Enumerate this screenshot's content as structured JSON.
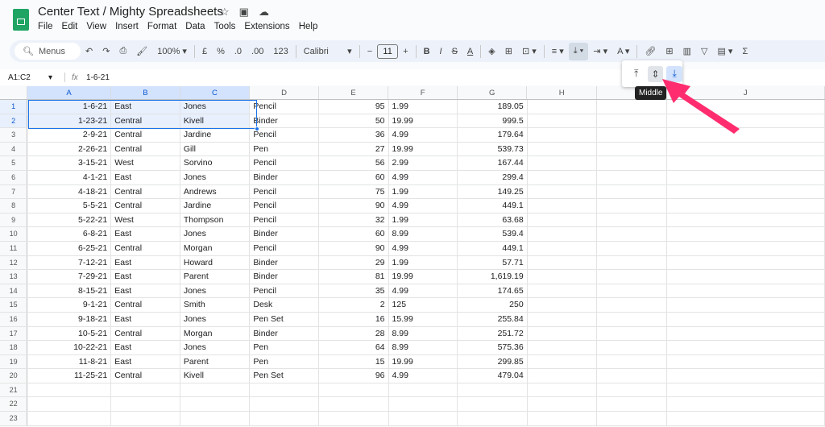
{
  "app": {
    "title": "Center Text / Mighty Spreadsheets",
    "menu": [
      "File",
      "Edit",
      "View",
      "Insert",
      "Format",
      "Data",
      "Tools",
      "Extensions",
      "Help"
    ]
  },
  "toolbar": {
    "search": "Menus",
    "zoom": "100%",
    "currency": "£",
    "percent": "%",
    "dec_less": ".0",
    "dec_more": ".00",
    "format": "123",
    "font": "Calibri",
    "font_size": "11"
  },
  "formula_bar": {
    "range": "A1:C2",
    "fx": "fx",
    "value": "1-6-21"
  },
  "valign_popup": {
    "options": [
      "Top",
      "Middle",
      "Bottom"
    ],
    "selected": "Bottom",
    "hovered": "Middle",
    "tooltip": "Middle"
  },
  "annotation_color": "#ff2d6f",
  "columns": [
    "A",
    "B",
    "C",
    "D",
    "E",
    "F",
    "G",
    "H",
    "",
    "J"
  ],
  "rows": [
    [
      "1-6-21",
      "East",
      "Jones",
      "Pencil",
      "95",
      "1.99",
      "189.05"
    ],
    [
      "1-23-21",
      "Central",
      "Kivell",
      "Binder",
      "50",
      "19.99",
      "999.5"
    ],
    [
      "2-9-21",
      "Central",
      "Jardine",
      "Pencil",
      "36",
      "4.99",
      "179.64"
    ],
    [
      "2-26-21",
      "Central",
      "Gill",
      "Pen",
      "27",
      "19.99",
      "539.73"
    ],
    [
      "3-15-21",
      "West",
      "Sorvino",
      "Pencil",
      "56",
      "2.99",
      "167.44"
    ],
    [
      "4-1-21",
      "East",
      "Jones",
      "Binder",
      "60",
      "4.99",
      "299.4"
    ],
    [
      "4-18-21",
      "Central",
      "Andrews",
      "Pencil",
      "75",
      "1.99",
      "149.25"
    ],
    [
      "5-5-21",
      "Central",
      "Jardine",
      "Pencil",
      "90",
      "4.99",
      "449.1"
    ],
    [
      "5-22-21",
      "West",
      "Thompson",
      "Pencil",
      "32",
      "1.99",
      "63.68"
    ],
    [
      "6-8-21",
      "East",
      "Jones",
      "Binder",
      "60",
      "8.99",
      "539.4"
    ],
    [
      "6-25-21",
      "Central",
      "Morgan",
      "Pencil",
      "90",
      "4.99",
      "449.1"
    ],
    [
      "7-12-21",
      "East",
      "Howard",
      "Binder",
      "29",
      "1.99",
      "57.71"
    ],
    [
      "7-29-21",
      "East",
      "Parent",
      "Binder",
      "81",
      "19.99",
      "1,619.19"
    ],
    [
      "8-15-21",
      "East",
      "Jones",
      "Pencil",
      "35",
      "4.99",
      "174.65"
    ],
    [
      "9-1-21",
      "Central",
      "Smith",
      "Desk",
      "2",
      "125",
      "250"
    ],
    [
      "9-18-21",
      "East",
      "Jones",
      "Pen Set",
      "16",
      "15.99",
      "255.84"
    ],
    [
      "10-5-21",
      "Central",
      "Morgan",
      "Binder",
      "28",
      "8.99",
      "251.72"
    ],
    [
      "10-22-21",
      "East",
      "Jones",
      "Pen",
      "64",
      "8.99",
      "575.36"
    ],
    [
      "11-8-21",
      "East",
      "Parent",
      "Pen",
      "15",
      "19.99",
      "299.85"
    ],
    [
      "11-25-21",
      "Central",
      "Kivell",
      "Pen Set",
      "96",
      "4.99",
      "479.04"
    ],
    [
      "",
      "",
      "",
      "",
      "",
      "",
      ""
    ],
    [
      "",
      "",
      "",
      "",
      "",
      "",
      ""
    ],
    [
      "",
      "",
      "",
      "",
      "",
      "",
      ""
    ]
  ]
}
